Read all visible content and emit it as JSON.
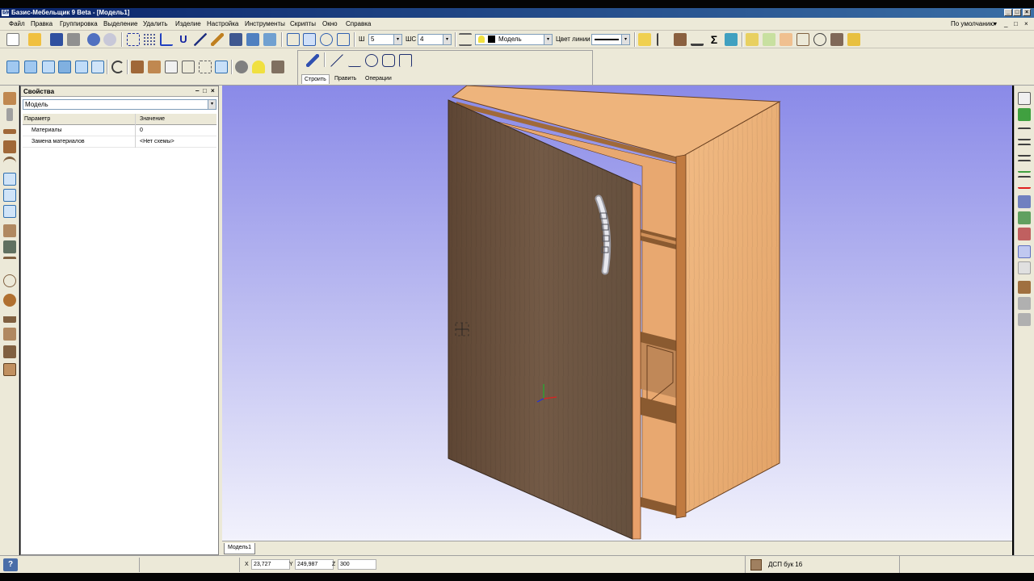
{
  "window": {
    "title": "Базис-Мебельщик 9 Beta - [Модель1]",
    "min_glyph": "_",
    "max_glyph": "□",
    "close_glyph": "×",
    "app_icon_text": "БМ"
  },
  "menu": {
    "items": [
      "Файл",
      "Правка",
      "Группировка",
      "Выделение",
      "Удалить",
      "Изделие",
      "Настройка",
      "Инструменты",
      "Скрипты",
      "Окно",
      "Справка"
    ],
    "layout_label": "По умолчанию",
    "layout_arrow": "▾",
    "min_glyph": "_",
    "restore_glyph": "□",
    "close_glyph": "×"
  },
  "toolbar": {
    "width_label": "Ш",
    "width_value": "5",
    "step_label": "ШС",
    "step_value": "4",
    "layer_value": "Модель",
    "line_color_label": "Цвет линии",
    "arrow": "▾"
  },
  "ribbon": {
    "tabs": [
      "Строить",
      "Править",
      "Операции"
    ],
    "active_tab": "Строить"
  },
  "properties": {
    "title": "Свойства",
    "header_btns": [
      "‒",
      "□",
      "×"
    ],
    "selector_value": "Модель",
    "selector_arrow": "▾",
    "columns": [
      "Параметр",
      "Значение"
    ],
    "rows": [
      {
        "param": "Материалы",
        "value": "0"
      },
      {
        "param": "Замена материалов",
        "value": "<Нет схемы>"
      }
    ]
  },
  "doc_tabs": [
    "Модель1"
  ],
  "status": {
    "help_glyph": "?",
    "x_label": "X",
    "x_value": "23,727",
    "y_label": "Y",
    "y_value": "249,987",
    "z_label": "Z",
    "z_value": "300",
    "material": "ДСП бук 16"
  },
  "colors": {
    "viewport_top": "#8a8ae8",
    "viewport_bottom": "#f2f2fc",
    "panel_beech": "#e8a86c",
    "panel_beech_dark": "#c8864c",
    "door_brown": "#6e5440",
    "accent_blue": "#0a246a"
  }
}
